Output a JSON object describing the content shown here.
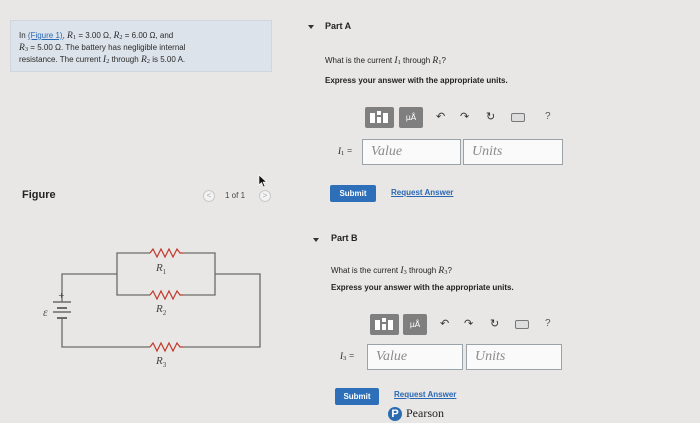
{
  "problem": {
    "intro": "In",
    "figure_link": "(Figure 1)",
    "r1_symbol": "R",
    "r1_sub": "1",
    "r1_value": "= 3.00 Ω",
    "r2_symbol": "R",
    "r2_sub": "2",
    "r2_value": "= 6.00 Ω",
    "and": ", and",
    "r3_symbol": "R",
    "r3_sub": "3",
    "r3_value": "= 5.00 Ω",
    "line2_rest": ". The battery has negligible internal",
    "line3_a": "resistance. The current",
    "i2_symbol": "I",
    "i2_sub": "2",
    "line3_b": "through",
    "line3_r": "R",
    "line3_r_sub": "2",
    "line3_c": "is 5.00 A."
  },
  "figure": {
    "label": "Figure",
    "pager_text": "1 of 1",
    "prev_glyph": "<",
    "next_glyph": ">",
    "emf_label": "ε",
    "r1_label": "R",
    "r1_sub": "1",
    "r2_label": "R",
    "r2_sub": "2",
    "r3_label": "R",
    "r3_sub": "3"
  },
  "parts": [
    {
      "title": "Part A",
      "question_a": "What is the current",
      "question_var": "I",
      "question_var_sub": "1",
      "question_b": "through",
      "question_r": "R",
      "question_r_sub": "1",
      "question_c": "?",
      "instruction": "Express your answer with the appropriate units.",
      "answer_var": "I",
      "answer_var_sub": "1",
      "answer_eq": "=",
      "value_placeholder": "Value",
      "units_placeholder": "Units",
      "mu_label": "μÅ",
      "help": "?",
      "submit": "Submit",
      "request": "Request Answer"
    },
    {
      "title": "Part B",
      "question_a": "What is the current",
      "question_var": "I",
      "question_var_sub": "3",
      "question_b": "through",
      "question_r": "R",
      "question_r_sub": "3",
      "question_c": "?",
      "instruction": "Express your answer with the appropriate units.",
      "answer_var": "I",
      "answer_var_sub": "3",
      "answer_eq": "=",
      "value_placeholder": "Value",
      "units_placeholder": "Units",
      "mu_label": "μÅ",
      "help": "?",
      "submit": "Submit",
      "request": "Request Answer"
    }
  ],
  "footer": {
    "logo_letter": "P",
    "brand": "Pearson"
  },
  "colors": {
    "accent": "#2d6fb8",
    "link": "#2a67b3",
    "problem_bg": "#dde3ea",
    "circuit": "#c0392b"
  }
}
